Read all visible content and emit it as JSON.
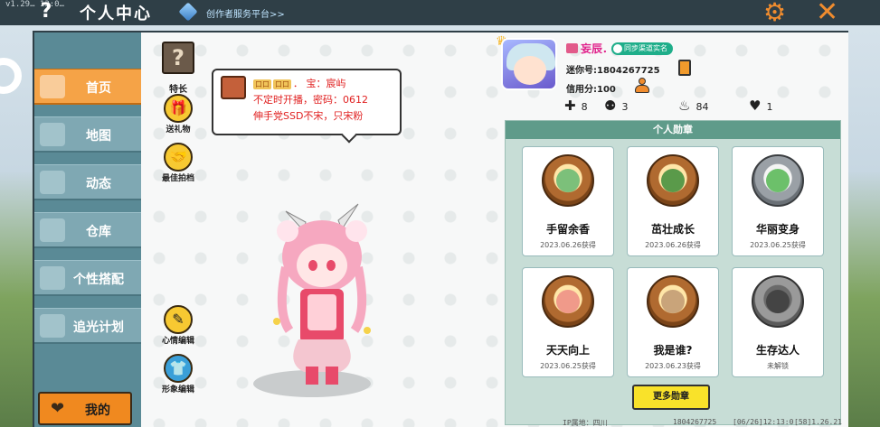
{
  "topbar": {
    "version": "v1.29…  13:0…",
    "help": "?",
    "title": "个人中心",
    "creator_link": "创作者服务平台>>",
    "gear_icon": "gear-icon",
    "close_icon": "close-icon"
  },
  "sidebar": {
    "items": [
      {
        "label": "首页",
        "active": true
      },
      {
        "label": "地图",
        "active": false
      },
      {
        "label": "动态",
        "active": false
      },
      {
        "label": "仓库",
        "active": false
      },
      {
        "label": "个性搭配",
        "active": false
      },
      {
        "label": "追光计划",
        "active": false
      }
    ],
    "mine_label": "我的"
  },
  "left_tools": {
    "special_label": "特长",
    "gift_label": "送礼物",
    "partner_label": "最佳拍档",
    "mood_label": "心情编辑",
    "look_label": "形象编辑"
  },
  "bubble": {
    "tag1": "口口",
    "tag2": "口口",
    "line1_rest": "．   宝：宸屿",
    "line2": "不定时开播，密码：0612",
    "line3": "伸手党SSD不宋，只宋粉"
  },
  "profile": {
    "name": "妄辰．",
    "sync_badge": "同步渠道实名",
    "mini_id": "迷你号:1804267725",
    "credit": "信用分:100",
    "stats": {
      "friends": "8",
      "fans": "3",
      "heat": "84",
      "likes": "1"
    }
  },
  "badges": {
    "title": "个人勋章",
    "items": [
      {
        "name": "手留余香",
        "date": "2023.06.26获得",
        "tier": "bronze"
      },
      {
        "name": "茁壮成长",
        "date": "2023.06.26获得",
        "tier": "bronze"
      },
      {
        "name": "华丽变身",
        "date": "2023.06.25获得",
        "tier": "silver"
      },
      {
        "name": "天天向上",
        "date": "2023.06.25获得",
        "tier": "bronze"
      },
      {
        "name": "我是谁?",
        "date": "2023.06.23获得",
        "tier": "bronze"
      },
      {
        "name": "生存达人",
        "date": "未解锁",
        "tier": "locked"
      }
    ],
    "more_button": "更多勋章"
  },
  "footer": {
    "ip": "IP属地：四川",
    "uid": "1804267725",
    "time": "[06/26]12:13:0",
    "build": "[58]1.26.21"
  },
  "colors": {
    "accent_orange": "#f08c2e",
    "nav_teal": "#7fa8b3",
    "badge_header": "#5f9b8a",
    "more_yellow": "#f9e22a"
  }
}
